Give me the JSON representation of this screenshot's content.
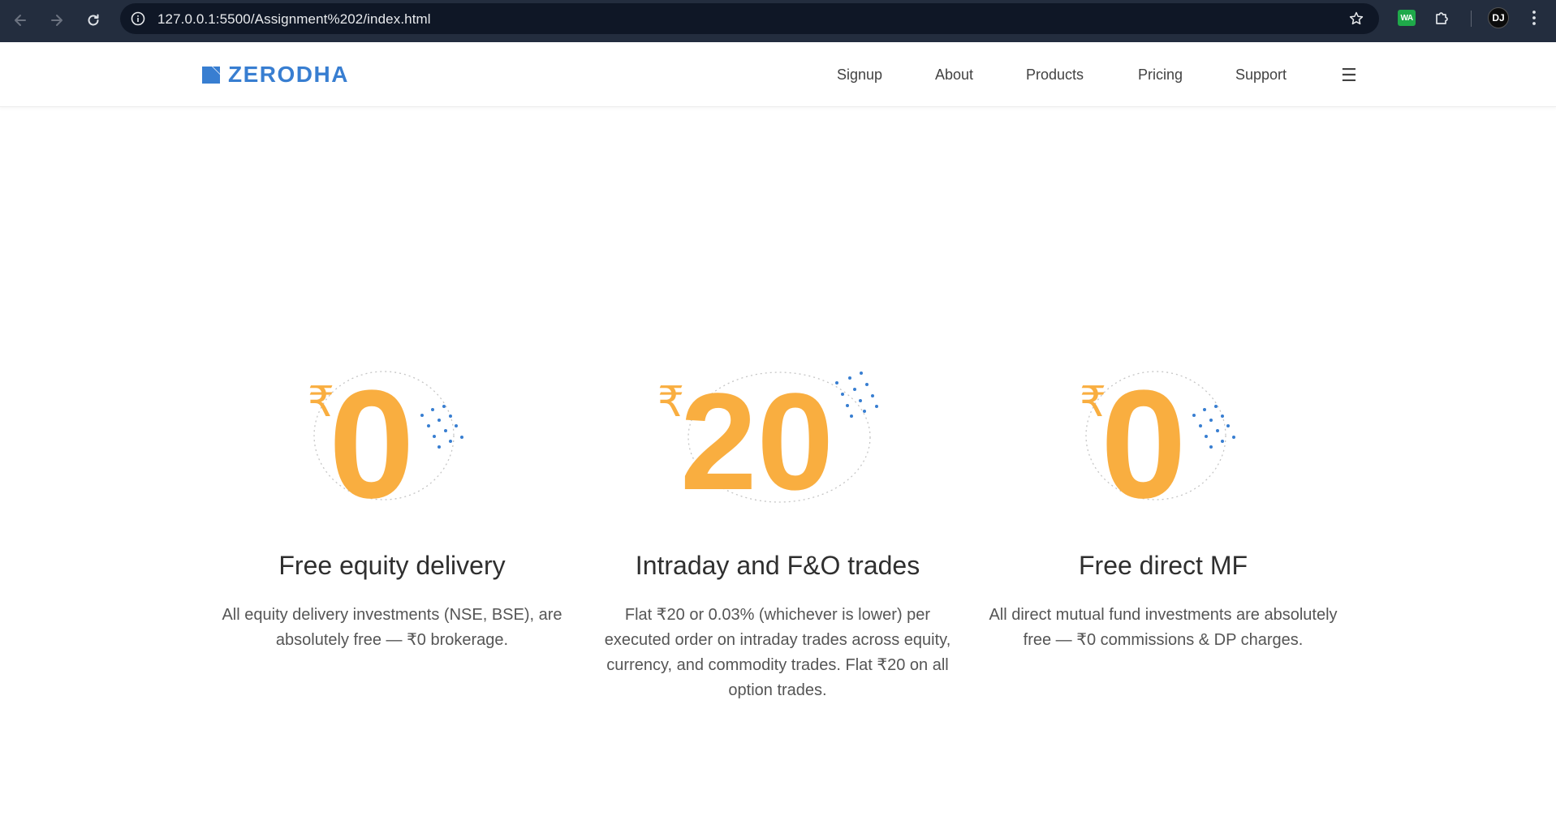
{
  "browser": {
    "url": "127.0.0.1:5500/Assignment%202/index.html",
    "extension_label": "WA",
    "profile_initials": "DJ",
    "icons": [
      "back-icon",
      "forward-icon",
      "reload-icon",
      "info-icon",
      "star-icon",
      "puzzle-icon",
      "kebab-menu-icon"
    ]
  },
  "nav": {
    "logo_text": "ZERODHA",
    "links": [
      "Signup",
      "About",
      "Products",
      "Pricing",
      "Support"
    ],
    "menu_glyph": "☰"
  },
  "colors": {
    "brand_blue": "#387ed1",
    "price_orange": "#f9ae40",
    "title_text": "#2f2f2f",
    "body_text": "#555555"
  },
  "cards": [
    {
      "rupee": "₹",
      "amount": "0",
      "title": "Free equity delivery",
      "text": "All equity delivery investments (NSE, BSE), are absolutely free — ₹0 brokerage."
    },
    {
      "rupee": "₹",
      "amount": "20",
      "title": "Intraday and F&O trades",
      "text": "Flat ₹20 or 0.03% (whichever is lower) per executed order on intraday trades across equity, currency, and commodity trades. Flat ₹20 on all option trades."
    },
    {
      "rupee": "₹",
      "amount": "0",
      "title": "Free direct MF",
      "text": "All direct mutual fund investments are absolutely free — ₹0 commissions & DP charges."
    }
  ]
}
